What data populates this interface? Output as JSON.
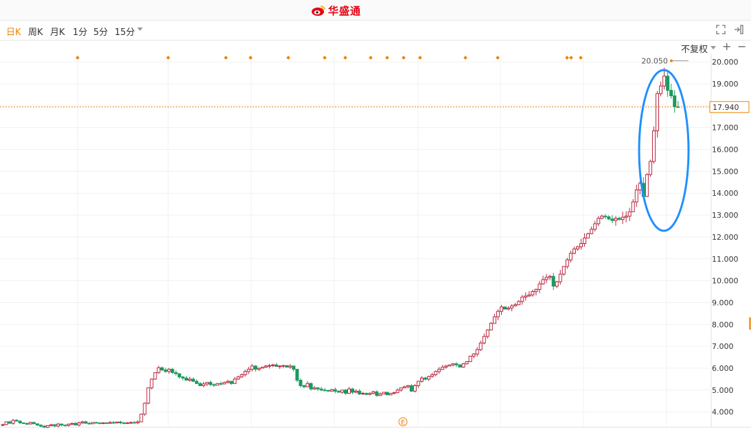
{
  "brand": {
    "name": "华盛通"
  },
  "periods": [
    {
      "label": "日K",
      "active": true
    },
    {
      "label": "周K",
      "active": false
    },
    {
      "label": "月K",
      "active": false
    },
    {
      "label": "1分",
      "active": false
    },
    {
      "label": "5分",
      "active": false
    },
    {
      "label": "15分",
      "active": false
    }
  ],
  "adjust_label": "不复权",
  "icons": {
    "fullscreen": "fullscreen-icon",
    "collapse": "collapse-panel-icon",
    "zoom_in": "plus-icon",
    "zoom_out": "minus-icon"
  },
  "colors": {
    "up": "#b8243c",
    "down": "#1a9a5e",
    "accent": "#f08200",
    "ellipse": "#1e90ff"
  },
  "chart_data": {
    "type": "candlestick",
    "ylim": [
      3.3,
      20.35
    ],
    "y_ticks": [
      "20.000",
      "19.000",
      "18.000",
      "17.000",
      "16.000",
      "15.000",
      "14.000",
      "13.000",
      "12.000",
      "11.000",
      "10.000",
      "9.000",
      "8.000",
      "7.000",
      "6.000",
      "5.000",
      "4.000"
    ],
    "y_tick_values": [
      20,
      19,
      18,
      17,
      16,
      15,
      14,
      13,
      12,
      11,
      10,
      9,
      8,
      7,
      6,
      5,
      4
    ],
    "current_price": "17.940",
    "current_price_value": 17.94,
    "high_marker_label": "20.050",
    "high_marker_value": 20.05,
    "event_marker_label": "E",
    "grid": true,
    "highlight": "ellipse",
    "closes": [
      3.42,
      3.55,
      3.48,
      3.62,
      3.58,
      3.5,
      3.47,
      3.45,
      3.52,
      3.46,
      3.4,
      3.35,
      3.3,
      3.38,
      3.42,
      3.36,
      3.45,
      3.4,
      3.38,
      3.44,
      3.48,
      3.4,
      3.5,
      3.55,
      3.48,
      3.46,
      3.52,
      3.5,
      3.47,
      3.5,
      3.48,
      3.52,
      3.5,
      3.54,
      3.5,
      3.48,
      3.5,
      3.52,
      3.5,
      3.55,
      3.9,
      4.4,
      5.1,
      5.5,
      5.8,
      6.02,
      5.92,
      5.85,
      5.95,
      5.8,
      5.75,
      5.6,
      5.55,
      5.45,
      5.5,
      5.4,
      5.3,
      5.2,
      5.28,
      5.35,
      5.25,
      5.22,
      5.3,
      5.28,
      5.35,
      5.4,
      5.3,
      5.5,
      5.6,
      5.7,
      5.85,
      5.95,
      6.1,
      5.95,
      6.0,
      6.05,
      6.1,
      6.12,
      6.15,
      6.08,
      6.1,
      6.12,
      6.05,
      6.1,
      5.95,
      5.45,
      5.2,
      5.15,
      5.3,
      5.05,
      5.1,
      5.05,
      5.0,
      4.98,
      4.95,
      5.02,
      4.95,
      4.9,
      5.0,
      4.85,
      5.05,
      4.9,
      4.95,
      4.82,
      4.85,
      4.8,
      4.85,
      4.92,
      4.75,
      4.82,
      4.9,
      4.78,
      4.85,
      4.88,
      5.0,
      5.1,
      5.15,
      5.2,
      4.95,
      5.2,
      5.4,
      5.55,
      5.5,
      5.62,
      5.7,
      5.85,
      5.95,
      6.05,
      6.1,
      6.15,
      6.2,
      6.15,
      6.05,
      6.2,
      6.3,
      6.55,
      6.65,
      6.85,
      7.15,
      7.45,
      7.75,
      8.05,
      8.35,
      8.6,
      8.8,
      8.7,
      8.75,
      8.85,
      8.9,
      9.05,
      9.25,
      9.3,
      9.35,
      9.5,
      9.6,
      9.85,
      10.05,
      10.15,
      10.2,
      9.75,
      9.95,
      10.3,
      10.65,
      10.95,
      11.25,
      11.45,
      11.55,
      11.7,
      11.95,
      12.15,
      12.35,
      12.6,
      12.85,
      12.95,
      12.92,
      12.82,
      12.75,
      12.85,
      12.8,
      12.9,
      12.95,
      13.15,
      13.6,
      14.15,
      14.45,
      13.85,
      14.85,
      15.45,
      16.85,
      18.55,
      18.9,
      19.35,
      18.7,
      18.45,
      17.95,
      17.94
    ]
  }
}
